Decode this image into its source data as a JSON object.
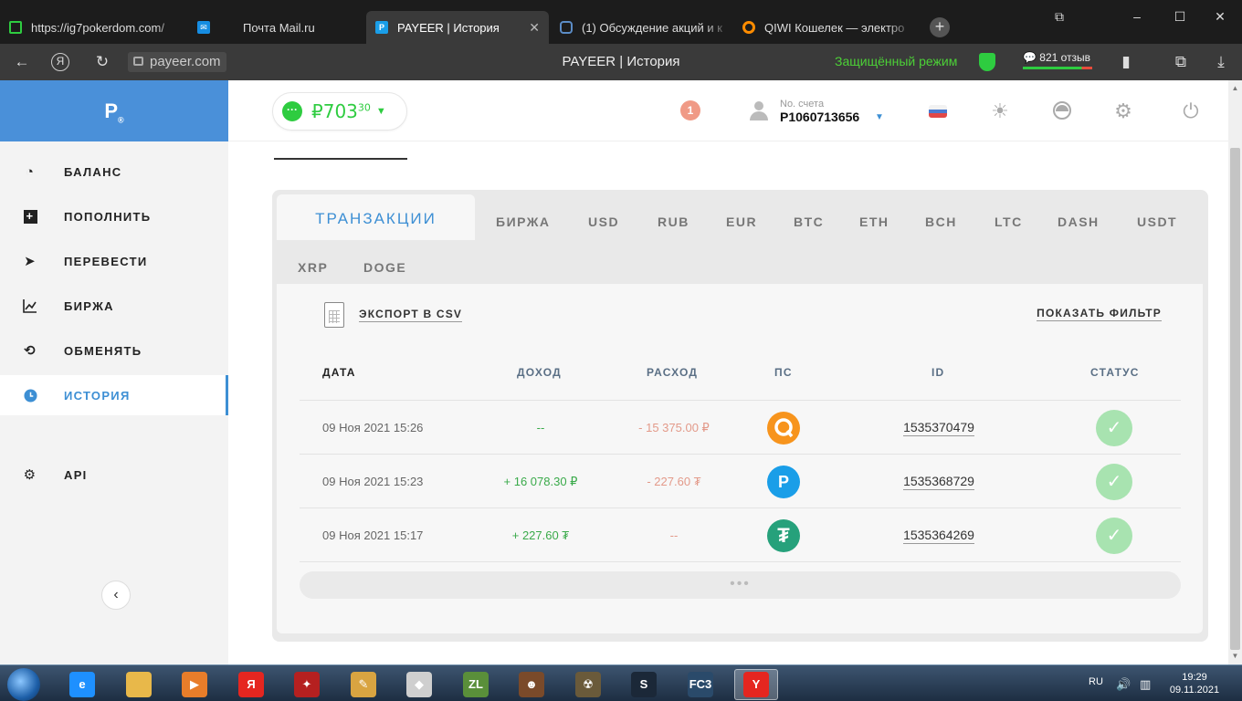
{
  "browser": {
    "tabs": [
      {
        "title": "https://ig7pokerdom.com/",
        "favicon_color": "#2ecc40"
      },
      {
        "title": "Почта Mail.ru",
        "favicon_color": "#168de2"
      },
      {
        "title": "PAYEER | История",
        "favicon_color": "#1a9ee8",
        "active": true
      },
      {
        "title": "(1) Обсуждение акций и к",
        "favicon_color": "#5b8cc6"
      },
      {
        "title": "QIWI Кошелек — электро",
        "favicon_color": "#ff8c00"
      }
    ],
    "url": "payeer.com",
    "page_title": "PAYEER | История",
    "secure_mode": "Защищённый режим",
    "reviews": "821 отзыв",
    "yandex_letter": "Я"
  },
  "sidebar": {
    "logo": "P",
    "logo_mark": "®",
    "items": [
      {
        "label": "БАЛАНС",
        "icon": "gauge-icon"
      },
      {
        "label": "ПОПОЛНИТЬ",
        "icon": "plus-square-icon"
      },
      {
        "label": "ПЕРЕВЕСТИ",
        "icon": "paper-plane-icon"
      },
      {
        "label": "БИРЖА",
        "icon": "chart-line-icon"
      },
      {
        "label": "ОБМЕНЯТЬ",
        "icon": "exchange-arrows-icon"
      },
      {
        "label": "ИСТОРИЯ",
        "icon": "clock-icon",
        "active": true
      },
      {
        "label": "API",
        "icon": "gears-icon"
      }
    ]
  },
  "topbar": {
    "balance_currency": "₽",
    "balance_main": "703",
    "balance_fraction": "30",
    "notifications": "1",
    "account_label": "No. счета",
    "account_number": "P1060713656"
  },
  "tabs": {
    "active": "ТРАНЗАКЦИИ",
    "others": [
      "БИРЖА",
      "USD",
      "RUB",
      "EUR",
      "BTC",
      "ETH",
      "BCH",
      "LTC",
      "DASH",
      "USDT",
      "XRP",
      "DOGE"
    ]
  },
  "actions": {
    "export": "ЭКСПОРТ В CSV",
    "filter": "ПОКАЗАТЬ ФИЛЬТР"
  },
  "table": {
    "headers": {
      "date": "ДАТА",
      "income": "ДОХОД",
      "expense": "РАСХОД",
      "ps": "ПС",
      "id": "ID",
      "status": "СТАТУС"
    },
    "rows": [
      {
        "date": "09 Ноя 2021 15:26",
        "income": "--",
        "expense": "- 15 375.00 ₽",
        "ps": "qiwi",
        "ps_color": "#f7941d",
        "ps_letter": "Q",
        "id": "1535370479",
        "status": "success"
      },
      {
        "date": "09 Ноя 2021 15:23",
        "income": "+ 16 078.30 ₽",
        "expense": "- 227.60 ₮",
        "ps": "payeer",
        "ps_color": "#1a9ee8",
        "ps_letter": "P",
        "id": "1535368729",
        "status": "success"
      },
      {
        "date": "09 Ноя 2021 15:17",
        "income": "+ 227.60 ₮",
        "expense": "--",
        "ps": "tether",
        "ps_color": "#26a17b",
        "ps_letter": "₮",
        "id": "1535364269",
        "status": "success"
      }
    ],
    "more": "•••"
  },
  "taskbar": {
    "lang": "RU",
    "time": "19:29",
    "date": "09.11.2021",
    "apps": [
      {
        "name": "ie-icon",
        "color": "#1e90ff",
        "label": "e"
      },
      {
        "name": "explorer-icon",
        "color": "#e8b84a",
        "label": ""
      },
      {
        "name": "media-player-icon",
        "color": "#e87d2a",
        "label": "▶"
      },
      {
        "name": "yandex-browser-icon",
        "color": "#e52620",
        "label": "Я"
      },
      {
        "name": "game-launcher-icon",
        "color": "#b52020",
        "label": "✦"
      },
      {
        "name": "paint-icon",
        "color": "#d9a441",
        "label": "✎"
      },
      {
        "name": "roblox-icon",
        "color": "#cfcfcf",
        "label": "◆"
      },
      {
        "name": "zona-icon",
        "color": "#5a8f3a",
        "label": "ZL"
      },
      {
        "name": "mafia-game-icon",
        "color": "#7a4a2a",
        "label": "☻"
      },
      {
        "name": "stalker-game-icon",
        "color": "#6a5a3a",
        "label": "☢"
      },
      {
        "name": "steam-icon",
        "color": "#1b2838",
        "label": "S"
      },
      {
        "name": "fc3-game-icon",
        "color": "#2a4a6a",
        "label": "FC3"
      },
      {
        "name": "yandex-icon",
        "color": "#e52620",
        "label": "Y",
        "active": true
      }
    ]
  }
}
